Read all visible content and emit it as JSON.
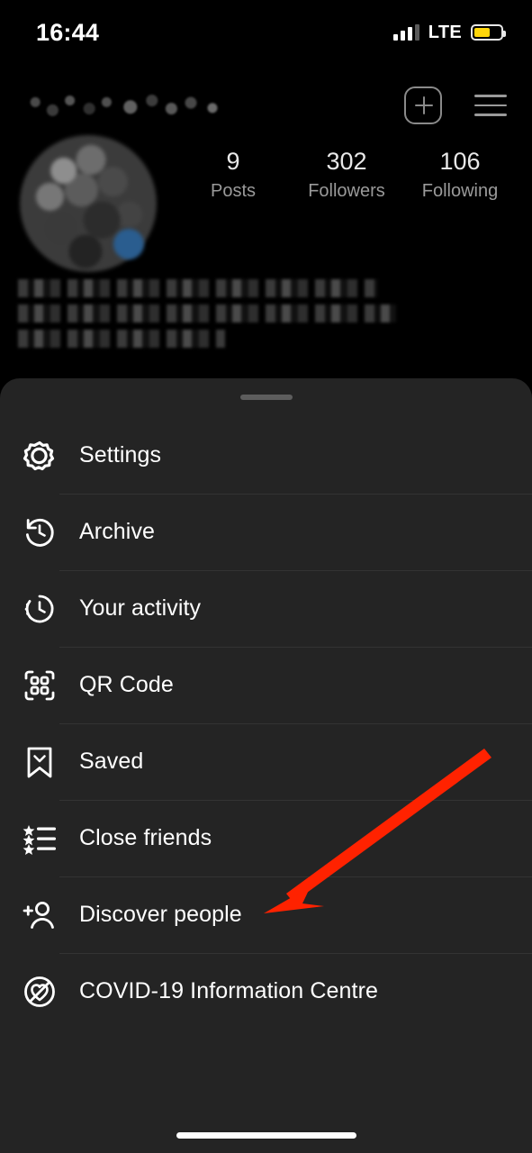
{
  "status_bar": {
    "time": "16:44",
    "network": "LTE",
    "signal_icon": "signal-bars-icon",
    "battery_icon": "battery-icon",
    "battery_color": "#ffd60a",
    "battery_level": 62
  },
  "profile": {
    "username_redacted": true,
    "avatar_redacted": true,
    "bio_redacted": true,
    "nav": {
      "add_icon": "plus-square-icon",
      "menu_icon": "hamburger-menu-icon"
    },
    "stats": [
      {
        "value": "9",
        "label": "Posts"
      },
      {
        "value": "302",
        "label": "Followers"
      },
      {
        "value": "106",
        "label": "Following"
      }
    ]
  },
  "sheet": {
    "grabber_icon": "drag-handle",
    "items": [
      {
        "label": "Settings",
        "icon": "gear-icon"
      },
      {
        "label": "Archive",
        "icon": "clock-rewind-icon"
      },
      {
        "label": "Your activity",
        "icon": "activity-clock-icon"
      },
      {
        "label": "QR Code",
        "icon": "qr-code-icon"
      },
      {
        "label": "Saved",
        "icon": "bookmark-icon"
      },
      {
        "label": "Close friends",
        "icon": "star-list-icon"
      },
      {
        "label": "Discover people",
        "icon": "person-add-icon"
      },
      {
        "label": "COVID-19 Information Centre",
        "icon": "heart-circle-icon"
      }
    ]
  },
  "annotation": {
    "arrow_color": "#ff2200",
    "points_at": "Discover people"
  },
  "home_indicator": "home-indicator"
}
